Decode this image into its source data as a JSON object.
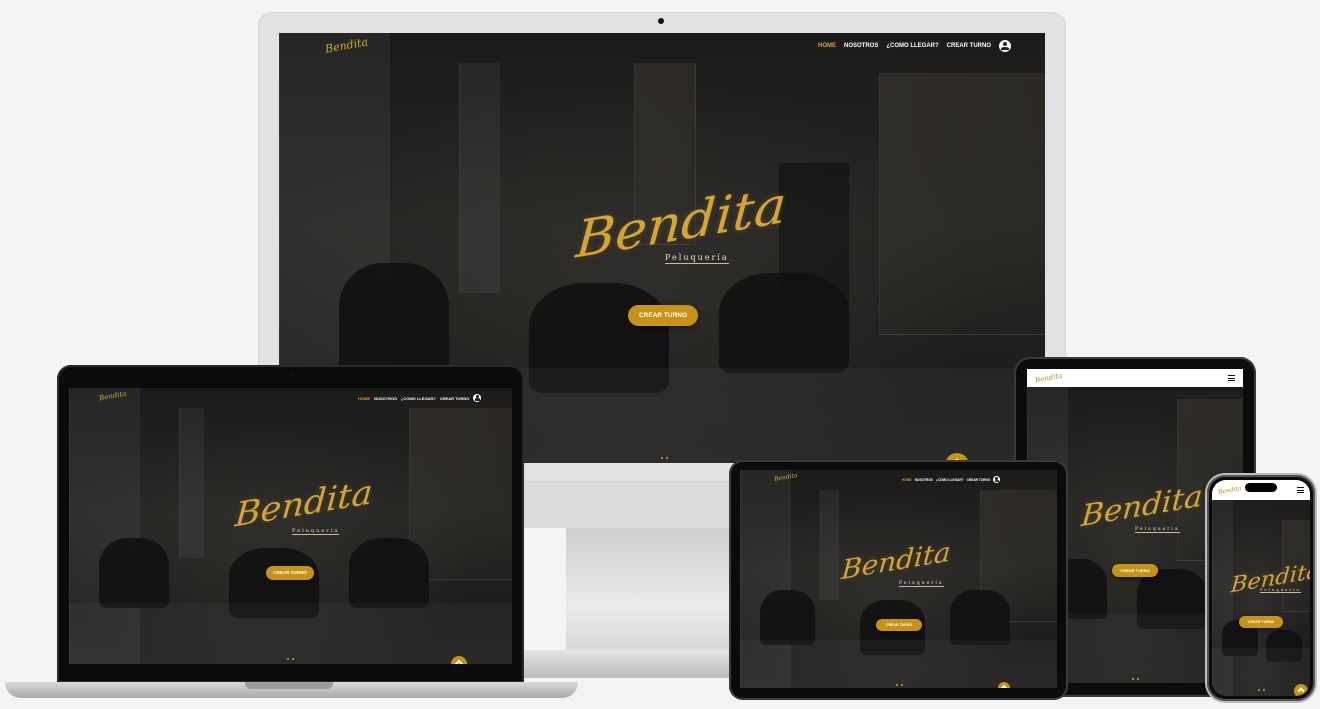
{
  "brand": {
    "script": "Bendita",
    "subtitle": "Peluquería"
  },
  "nav": {
    "items": [
      "HOME",
      "NOSOTROS",
      "¿COMO LLEGAR?",
      "CREAR TURNO"
    ],
    "active": "HOME",
    "account_icon": "user-circle-icon",
    "menu_icon": "hamburger-icon"
  },
  "hero": {
    "cta_label": "CREAR TURNO",
    "scroll_icon": "chevron-up-icon"
  },
  "colors": {
    "accent": "#c69318",
    "gold": "#d4a535",
    "background": "#f4f4f2"
  }
}
